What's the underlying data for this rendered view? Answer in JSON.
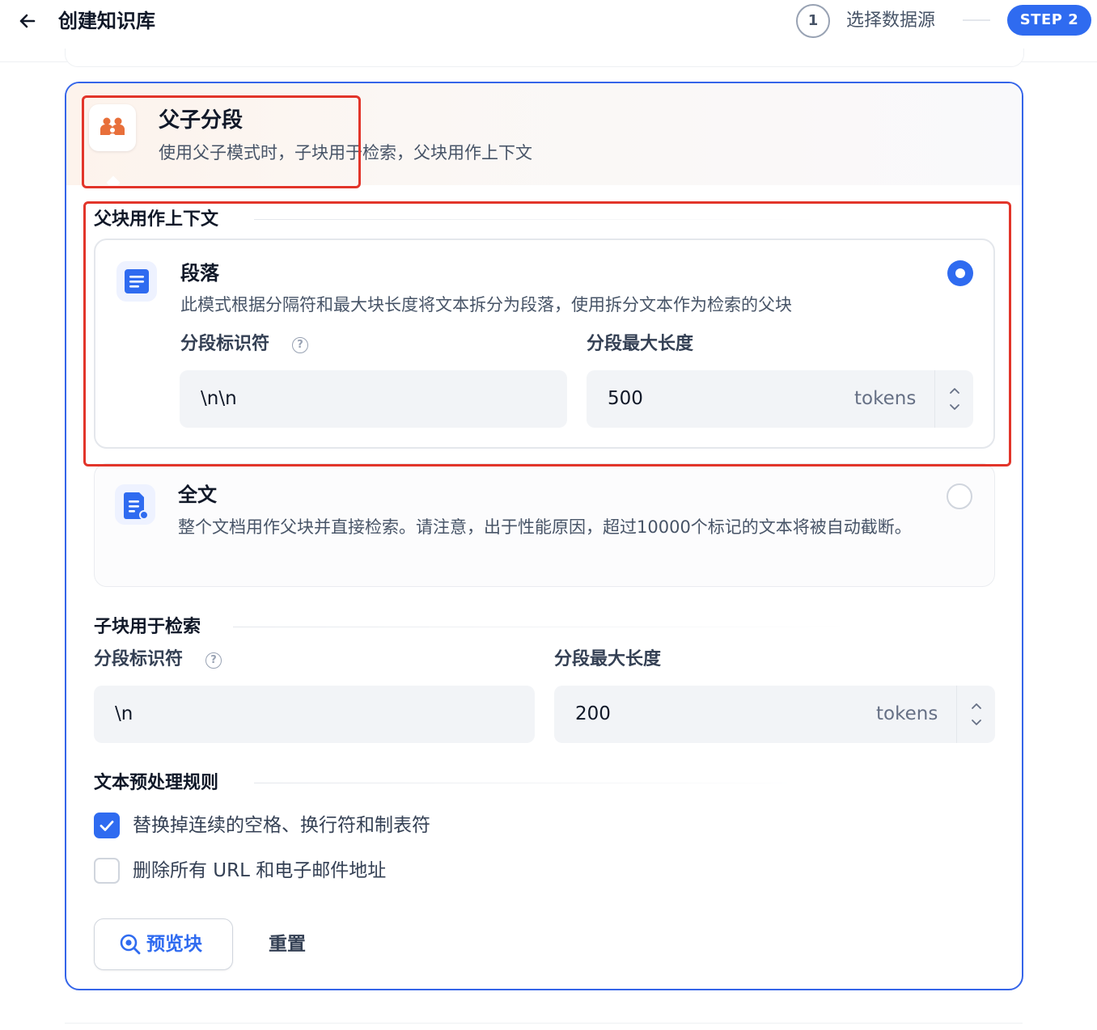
{
  "header": {
    "title": "创建知识库",
    "step1_number": "1",
    "step1_label": "选择数据源",
    "step2_label": "STEP 2"
  },
  "mode": {
    "title": "父子分段",
    "description": "使用父子模式时，子块用于检索，父块用作上下文"
  },
  "parent": {
    "section_title": "父块用作上下文",
    "options": [
      {
        "title": "段落",
        "description": "此模式根据分隔符和最大块长度将文本拆分为段落，使用拆分文本作为检索的父块",
        "selected": true
      },
      {
        "title": "全文",
        "description": "整个文档用作父块并直接检索。请注意，出于性能原因，超过10000个标记的文本将被自动截断。",
        "selected": false
      }
    ],
    "separator_label": "分段标识符",
    "separator_value": "\\n\\n",
    "max_length_label": "分段最大长度",
    "max_length_value": "500",
    "unit": "tokens"
  },
  "child": {
    "section_title": "子块用于检索",
    "separator_label": "分段标识符",
    "separator_value": "\\n",
    "max_length_label": "分段最大长度",
    "max_length_value": "200",
    "unit": "tokens"
  },
  "preprocessing": {
    "section_title": "文本预处理规则",
    "rules": [
      {
        "label": "替换掉连续的空格、换行符和制表符",
        "checked": true
      },
      {
        "label": "删除所有 URL 和电子邮件地址",
        "checked": false
      }
    ]
  },
  "actions": {
    "preview_label": "预览块",
    "reset_label": "重置"
  },
  "colors": {
    "accent": "#2f6bf0",
    "highlight_border": "#e2352a",
    "mode_icon": "#e86f3a"
  }
}
